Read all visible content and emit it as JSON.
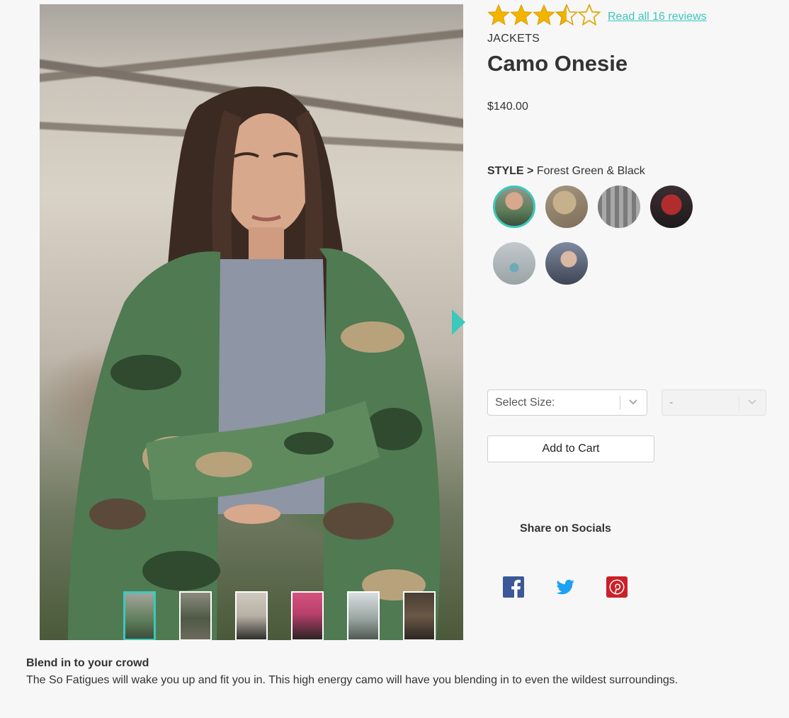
{
  "product": {
    "category": "JACKETS",
    "title": "Camo Onesie",
    "price": "$140.00",
    "rating": 3.5,
    "rating_max": 5,
    "reviews_link": "Read all 16 reviews"
  },
  "style": {
    "label": "STYLE >",
    "selected": "Forest Green & Black",
    "swatches": [
      {
        "name": "forest-green-camo",
        "color": "#5e7d5a"
      },
      {
        "name": "desert-camo",
        "color": "#9a8a74"
      },
      {
        "name": "urban-grey",
        "color": "#8e8e8e"
      },
      {
        "name": "red-black",
        "color": "#5a2a2e"
      },
      {
        "name": "snow-white",
        "color": "#c9cfd2"
      },
      {
        "name": "navy-blue",
        "color": "#5a6478"
      }
    ]
  },
  "size_select": {
    "placeholder": "Select Size:"
  },
  "qty_select": {
    "value": "-"
  },
  "cart_button": "Add to Cart",
  "share": {
    "title": "Share on Socials",
    "networks": [
      "facebook",
      "twitter",
      "pinterest"
    ]
  },
  "gallery": {
    "thumbnail_count": 6,
    "active_index": 0
  },
  "description": {
    "title": "Blend in to your crowd",
    "body": "The So Fatigues will wake you up and fit you in. This high energy camo will have you blending in to even the wildest surroundings."
  },
  "colors": {
    "accent": "#3cc8bd",
    "star": "#f3b400",
    "text": "#333333",
    "background": "#f7f7f7"
  }
}
